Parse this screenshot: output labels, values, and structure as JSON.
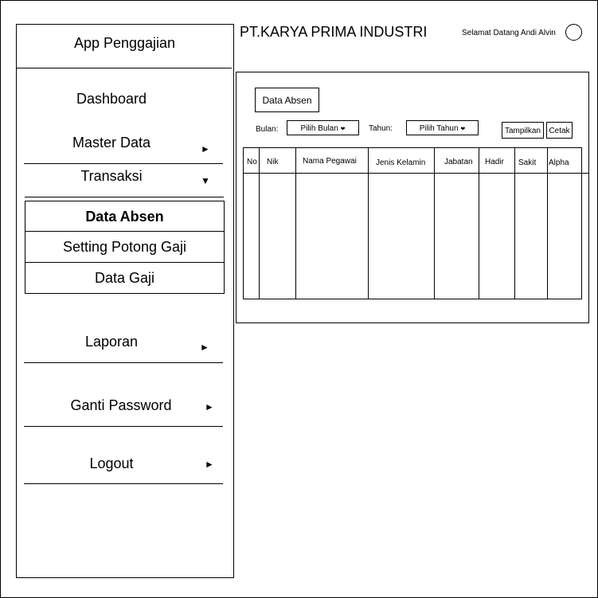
{
  "sidebar": {
    "app_title": "App Penggajian",
    "items": [
      {
        "label": "Dashboard"
      },
      {
        "label": "Master Data",
        "arrow": "►"
      },
      {
        "label": "Transaksi",
        "arrow": "▼"
      },
      {
        "label": "Laporan",
        "arrow": "►"
      },
      {
        "label": "Ganti Password",
        "arrow": "►"
      },
      {
        "label": "Logout",
        "arrow": "►"
      }
    ],
    "submenu": [
      {
        "label": "Data Absen",
        "active": true
      },
      {
        "label": "Setting Potong Gaji"
      },
      {
        "label": "Data Gaji"
      }
    ]
  },
  "header": {
    "company": "PT.KARYA PRIMA INDUSTRI",
    "welcome": "Selamat Datang Andi Alvin"
  },
  "main": {
    "title": "Data Absen",
    "filters": {
      "bulan_label": "Bulan:",
      "bulan_value": "Pilih Bulan",
      "tahun_label": "Tahun:",
      "tahun_value": "Pilih Tahun"
    },
    "buttons": {
      "show": "Tampilkan",
      "print": "Cetak"
    },
    "table": {
      "columns": [
        "No",
        "Nik",
        "Nama Pegawai",
        "Jenis Kelamin",
        "Jabatan",
        "Hadir",
        "Sakit",
        "Alpha"
      ],
      "rows": []
    }
  },
  "icons": {
    "dropdown": "❤"
  }
}
